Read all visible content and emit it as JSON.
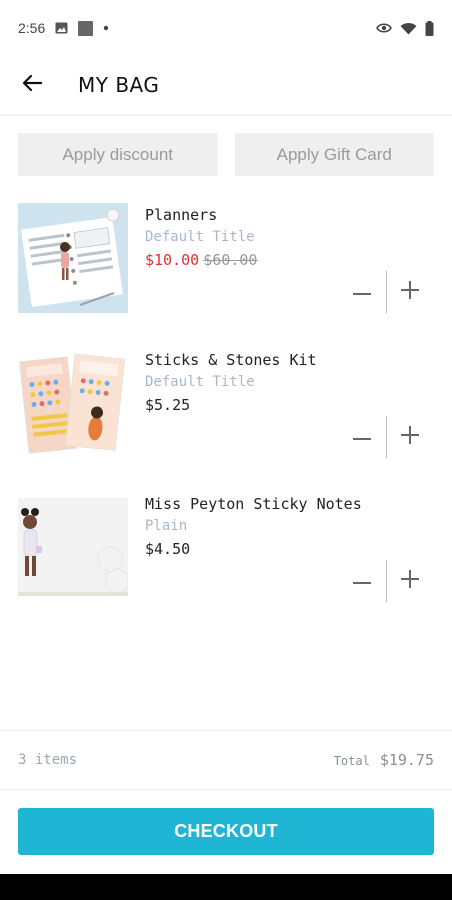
{
  "status_bar": {
    "time": "2:56",
    "icons_left": [
      "image-icon",
      "square-icon",
      "dot-icon"
    ],
    "icons_right": [
      "eye-icon",
      "wifi-icon",
      "battery-icon"
    ]
  },
  "header": {
    "title": "MY BAG",
    "back_icon": "arrow-left-icon"
  },
  "promo": {
    "discount_label": "Apply discount",
    "gift_card_label": "Apply Gift Card"
  },
  "items": [
    {
      "name": "Planners",
      "variant": "Default Title",
      "price": "$10.00",
      "compare_price": "$60.00",
      "on_sale": true
    },
    {
      "name": "Sticks & Stones Kit",
      "variant": "Default Title",
      "price": "$5.25"
    },
    {
      "name": "Miss Peyton Sticky Notes",
      "variant": "Plain",
      "price": "$4.50"
    }
  ],
  "summary": {
    "item_count": "3 items",
    "total_label": "Total",
    "total_value": "$19.75"
  },
  "checkout": {
    "label": "CHECKOUT"
  },
  "colors": {
    "accent": "#1fb5d4",
    "sale": "#e0302f",
    "muted": "#a9b7c9",
    "button_bg": "#efefef"
  }
}
